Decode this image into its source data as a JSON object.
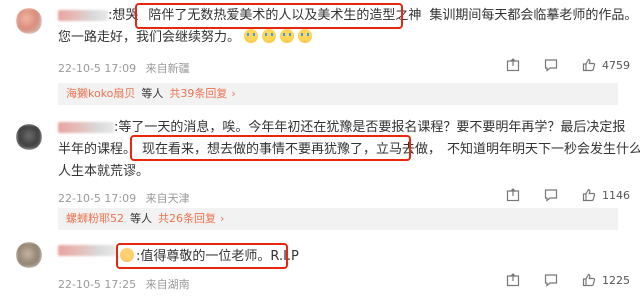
{
  "colors": {
    "highlight_border": "#e8270e",
    "link_orange": "#eb7350",
    "meta_gray": "#9a9a9a",
    "reply_bg": "#f2f2f2"
  },
  "comments": [
    {
      "name_suffix": ":想哭",
      "highlight_text": "陪伴了无数热爱美术的人以及美术生的造型之神",
      "text_rest_line1": "集训期间每天都会临摹老师的作品。",
      "line2": "您一路走好，我们会继续努力。",
      "emoji_icons": [
        "crying-emoji",
        "crying-emoji",
        "crying-emoji",
        "crying-emoji"
      ],
      "date": "22-10-5 17:09",
      "location": "来自新疆",
      "like_count": "4759",
      "reply_user": "海獭koko扇贝",
      "reply_mid": "等人",
      "reply_count": "共39条回复"
    },
    {
      "name_suffix": ":等了一天的消息，唉。今年年初还在犹豫是否要报名课程？要不要明年再学？最后决定报",
      "line2_prefix": "半年的课程。",
      "highlight_text": "现在看来，想去做的事情不要再犹豫了，立马去做，",
      "line2_rest": "不知道明年明天下一秒会发生什么事。",
      "line3": "人生本就荒谬。",
      "date": "22-10-5 17:09",
      "location": "来自天津",
      "like_count": "1146",
      "reply_user": "螺蛳粉耶52",
      "reply_mid": "等人",
      "reply_count": "共26条回复"
    },
    {
      "highlight_text": ":值得尊敬的一位老师。R.I.P",
      "date": "22-10-5 17:25",
      "location": "来自湖南",
      "like_count": "1225"
    }
  ],
  "icons": {
    "share": "share-icon",
    "comment": "comment-icon",
    "like": "like-icon"
  }
}
